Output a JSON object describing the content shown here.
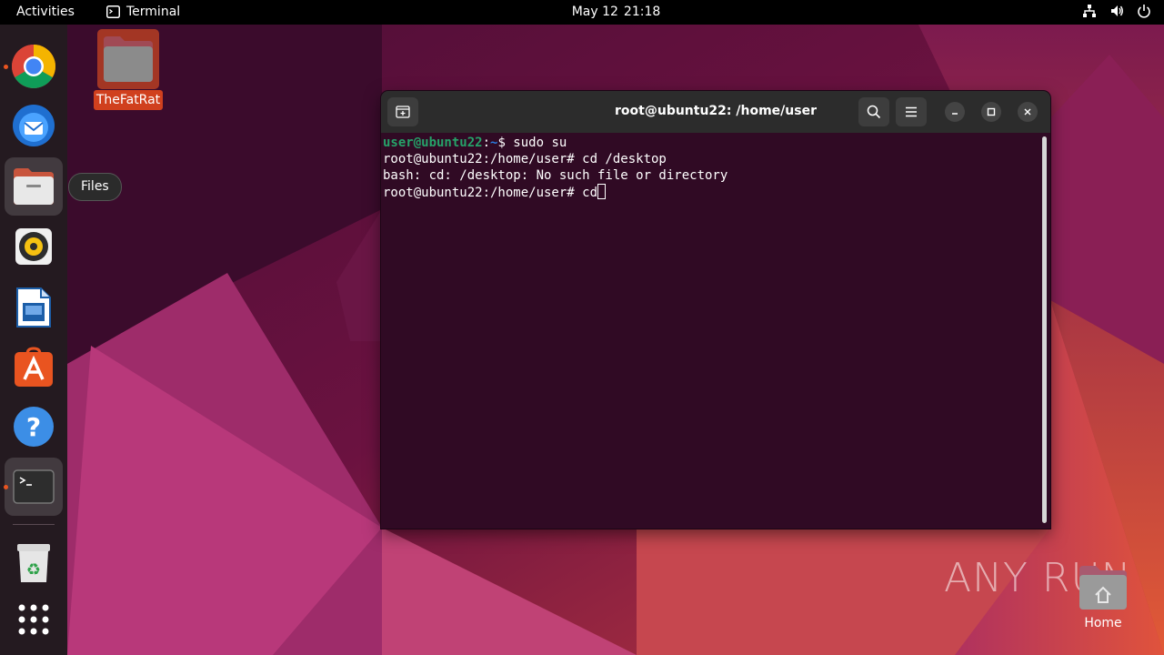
{
  "topbar": {
    "activities": "Activities",
    "app_name": "Terminal",
    "date": "May 12",
    "time": "21:18",
    "tray_icons": [
      "network-icon",
      "volume-icon",
      "power-icon"
    ]
  },
  "dock": {
    "items": [
      {
        "name": "chrome",
        "icon": "chrome-icon",
        "running": true
      },
      {
        "name": "thunderbird",
        "icon": "thunderbird-icon",
        "running": false
      },
      {
        "name": "files",
        "icon": "files-icon",
        "running": false,
        "tooltip": "Files"
      },
      {
        "name": "rhythmbox",
        "icon": "rhythmbox-icon",
        "running": false
      },
      {
        "name": "libreoffice-writer",
        "icon": "writer-icon",
        "running": false
      },
      {
        "name": "app-center",
        "icon": "app-center-icon",
        "running": false
      },
      {
        "name": "help",
        "icon": "help-icon",
        "running": false
      },
      {
        "name": "terminal",
        "icon": "terminal-icon",
        "running": true
      },
      {
        "name": "trash",
        "icon": "trash-icon",
        "running": false
      },
      {
        "name": "show-apps",
        "icon": "app-grid-icon",
        "running": false
      }
    ],
    "tooltip": "Files"
  },
  "desktop": {
    "folder_label": "TheFatRat",
    "home_label": "Home"
  },
  "terminal": {
    "title": "root@ubuntu22: /home/user",
    "lines": [
      {
        "user": "user@ubuntu22",
        "sep": ":",
        "path": "~",
        "rest": "$ sudo su"
      },
      {
        "text": "root@ubuntu22:/home/user# cd /desktop"
      },
      {
        "text": "bash: cd: /desktop: No such file or directory"
      },
      {
        "text": "root@ubuntu22:/home/user# cd"
      }
    ]
  },
  "watermark": "ANY RUN",
  "colors": {
    "accent": "#e95420",
    "terminal_bg": "#300a24",
    "prompt_user": "#26a269",
    "prompt_path": "#2a7bde"
  }
}
